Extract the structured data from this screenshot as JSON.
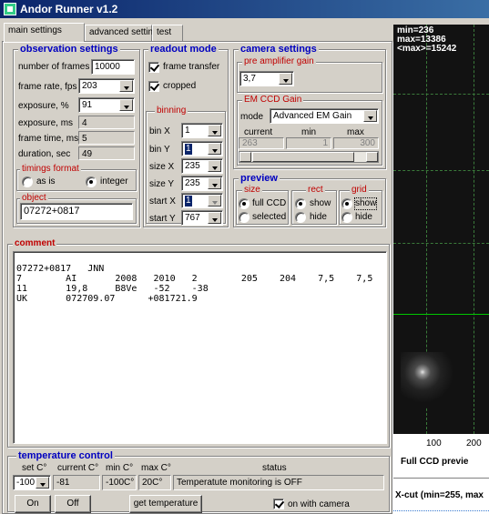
{
  "window": {
    "title": "Andor Runner v1.2"
  },
  "tabs": [
    "main settings",
    "advanced settings",
    "test"
  ],
  "observation": {
    "title": "observation settings",
    "frames_label": "number of frames",
    "frames_value": "10000",
    "rate_label": "frame rate, fps",
    "rate_value": "203",
    "exposure_pct_label": "exposure, %",
    "exposure_pct_value": "91",
    "exposure_ms_label": "exposure, ms",
    "exposure_ms_value": "4",
    "frame_time_label": "frame time, ms",
    "frame_time_value": "5",
    "duration_label": "duration, sec",
    "duration_value": "49",
    "timings_title": "timings format",
    "as_is_label": "as is",
    "integer_label": "integer",
    "object_title": "object",
    "object_value": "07272+0817"
  },
  "readout": {
    "title": "readout mode",
    "frame_transfer_label": "frame transfer",
    "cropped_label": "cropped",
    "binning_title": "binning",
    "bin_x_label": "bin X",
    "bin_x_value": "1",
    "bin_y_label": "bin Y",
    "bin_y_value": "1",
    "size_x_label": "size X",
    "size_x_value": "235",
    "size_y_label": "size Y",
    "size_y_value": "235",
    "start_x_label": "start X",
    "start_x_value": "1",
    "start_y_label": "start Y",
    "start_y_value": "767"
  },
  "camera": {
    "title": "camera settings",
    "preamp_title": "pre amplifier gain",
    "preamp_value": "3,7",
    "emccd_title": "EM CCD Gain",
    "mode_label": "mode",
    "mode_value": "Advanced EM Gain",
    "current_label": "current",
    "min_label": "min",
    "max_label": "max",
    "current_value": "263",
    "min_value": "1",
    "max_value": "300"
  },
  "preview": {
    "title": "preview",
    "size_title": "size",
    "full_ccd_label": "full CCD",
    "selected_label": "selected",
    "rect_title": "rect",
    "rect_show_label": "show",
    "rect_hide_label": "hide",
    "grid_title": "grid",
    "grid_show_label": "show",
    "grid_hide_label": "hide"
  },
  "comment": {
    "title": "comment",
    "lines": [
      "07272+0817   JNN",
      "7        AI       2008   2010   2        205    204    7,5    7,5     3,",
      "11       19,8     B8Ve   -52    -38                                    N",
      "UK       072709.07      +081721.9"
    ]
  },
  "temperature": {
    "title": "temperature control",
    "set_label": "set C°",
    "current_label": "current C°",
    "min_label": "min C°",
    "max_label": "max C°",
    "status_label": "status",
    "set_value": "-100",
    "current_value": "-81",
    "min_value": "-100C°",
    "max_value": "20C°",
    "status_value": "Temperatute monitoring is OFF",
    "on_label": "On",
    "off_label": "Off",
    "get_label": "get temperature",
    "on_with_camera_label": "on with camera"
  },
  "ccd_preview": {
    "stats": [
      "min=236",
      "max=13386",
      "<max>=15242"
    ],
    "tick_100": "100",
    "tick_200": "200",
    "caption": "Full CCD previe",
    "xcut": "X-cut (min=255, max"
  },
  "colors": {
    "group_title": "#0000c0",
    "subgroup_title": "#c00000",
    "face": "#d4d0c8",
    "titlebar": "#0a246a"
  }
}
